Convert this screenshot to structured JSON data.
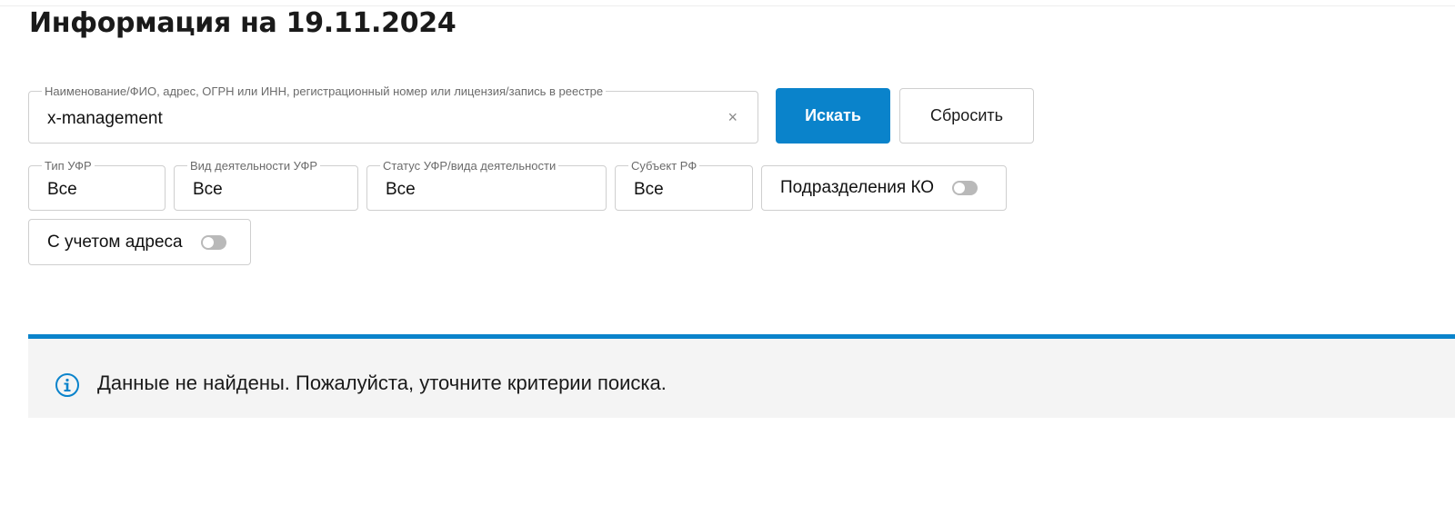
{
  "page": {
    "title": "Информация на 19.11.2024"
  },
  "search": {
    "legend": "Наименование/ФИО, адрес, ОГРН или ИНН, регистрационный номер или лицензия/запись в реестре",
    "value": "x-management",
    "clear_symbol": "×"
  },
  "buttons": {
    "search_label": "Искать",
    "reset_label": "Сбросить"
  },
  "filters": [
    {
      "legend": "Тип УФР",
      "value": "Все"
    },
    {
      "legend": "Вид деятельности УФР",
      "value": "Все"
    },
    {
      "legend": "Статус УФР/вида деятельности",
      "value": "Все"
    },
    {
      "legend": "Субъект РФ",
      "value": "Все"
    }
  ],
  "toggles": [
    {
      "label": "Подразделения КО",
      "on": false
    },
    {
      "label": "С учетом адреса",
      "on": false
    }
  ],
  "alert": {
    "message": "Данные не найдены. Пожалуйста, уточните критерии поиска.",
    "icon": "info-icon"
  },
  "colors": {
    "accent": "#0a83cb",
    "alert_bg": "#f4f4f4",
    "border": "#cfcfcf",
    "toggle_off": "#b9b9b9"
  }
}
